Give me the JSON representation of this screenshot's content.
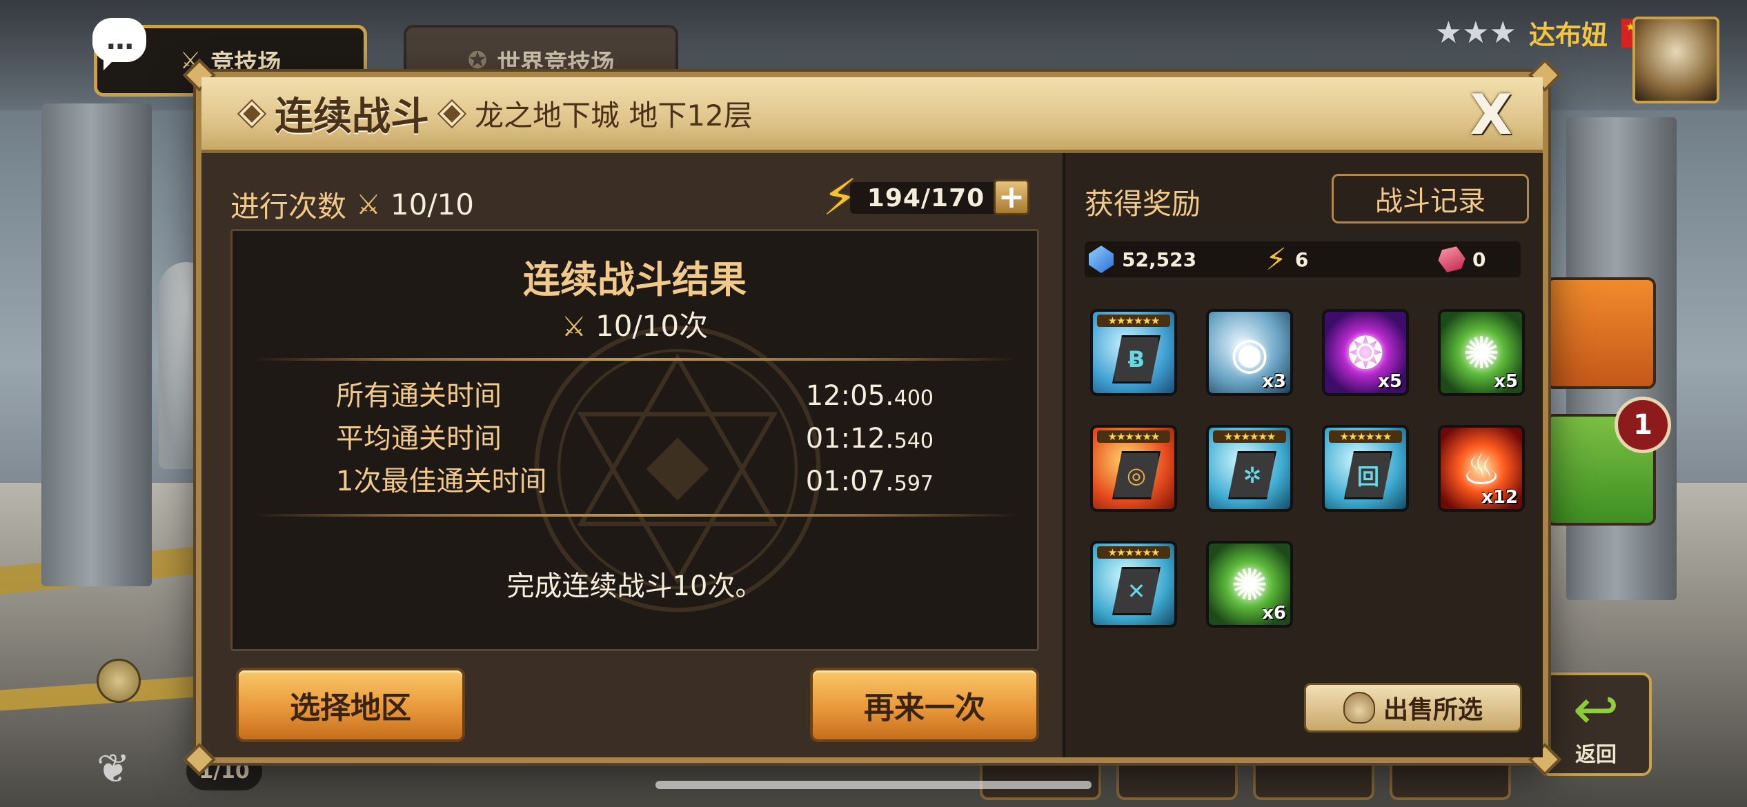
{
  "background": {
    "tab_arena": "竞技场",
    "tab_world_arena": "世界竞技场",
    "chat_icon": "...",
    "player_name": "达布妞",
    "player_stars": "★★★",
    "notification_count": "1",
    "return_label": "返回",
    "bottom_counter": "1/10"
  },
  "dialog": {
    "title": "连续战斗",
    "subtitle": "龙之地下城 地下12层",
    "close_label": "X"
  },
  "progress": {
    "label": "进行次数",
    "value": "10/10"
  },
  "energy": {
    "value": "194/170",
    "add_label": "+"
  },
  "result": {
    "title": "连续战斗结果",
    "count": "10/10次",
    "rows": [
      {
        "label": "所有通关时间",
        "time": "12:05.",
        "ms": "400"
      },
      {
        "label": "平均通关时间",
        "time": "01:12.",
        "ms": "540"
      },
      {
        "label": "1次最佳通关时间",
        "time": "01:07.",
        "ms": "597"
      }
    ],
    "completion_text": "完成连续战斗10次。"
  },
  "buttons": {
    "select_area": "选择地区",
    "again": "再来一次",
    "battle_log": "战斗记录",
    "sell_selected": "出售所选"
  },
  "rewards": {
    "title": "获得奖励",
    "currencies": [
      {
        "icon": "crystal-icon",
        "value": "52,523"
      },
      {
        "icon": "energy-bolt-icon",
        "value": "6"
      },
      {
        "icon": "red-gem-icon",
        "value": "0"
      }
    ],
    "items": [
      {
        "name": "rune-6star-blue",
        "stars": "★★★★★★",
        "glyph": "Ƀ",
        "qty": ""
      },
      {
        "name": "shapeshifting-stone-icon",
        "stars": "",
        "glyph": "◉",
        "qty": "x3"
      },
      {
        "name": "essence-dark-icon",
        "stars": "",
        "glyph": "❂",
        "qty": "x5"
      },
      {
        "name": "essence-wind-icon",
        "stars": "",
        "glyph": "✺",
        "qty": "x5"
      },
      {
        "name": "rune-6star-red",
        "stars": "★★★★★★",
        "glyph": "◎",
        "qty": ""
      },
      {
        "name": "rune-6star-teal-a",
        "stars": "★★★★★★",
        "glyph": "✲",
        "qty": ""
      },
      {
        "name": "rune-6star-teal-b",
        "stars": "★★★★★★",
        "glyph": "回",
        "qty": ""
      },
      {
        "name": "essence-fire-icon",
        "stars": "",
        "glyph": "♨",
        "qty": "x12"
      },
      {
        "name": "rune-6star-teal-c",
        "stars": "★★★★★★",
        "glyph": "✕",
        "qty": ""
      },
      {
        "name": "essence-wind-icon-2",
        "stars": "",
        "glyph": "✺",
        "qty": "x6"
      }
    ]
  },
  "colors": {
    "accent_gold": "#f1c98a",
    "header_bg": "#e0c58b",
    "button_orange": "#e9983a",
    "panel_dark": "#3b2f25"
  }
}
